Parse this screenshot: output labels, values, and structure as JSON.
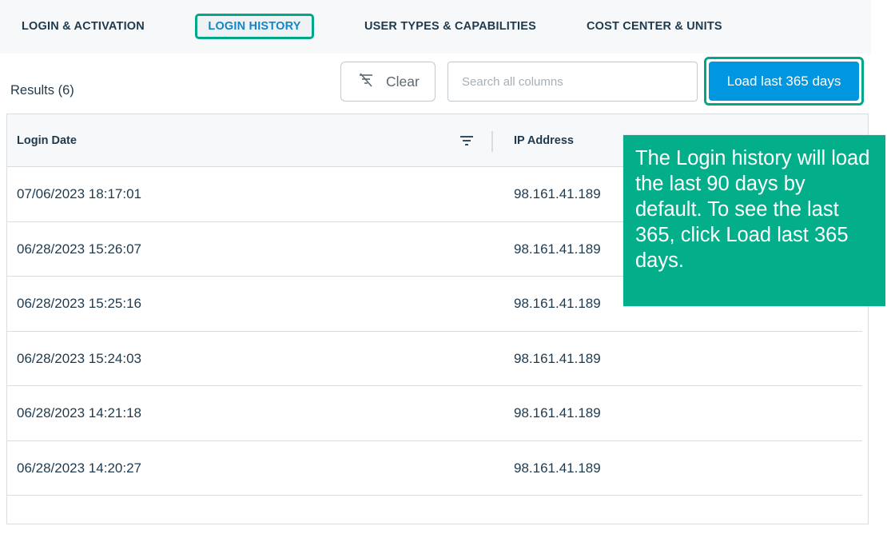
{
  "tabs": [
    {
      "label": "LOGIN & ACTIVATION"
    },
    {
      "label": "LOGIN HISTORY"
    },
    {
      "label": "USER TYPES & CAPABILITIES"
    },
    {
      "label": "COST CENTER & UNITS"
    }
  ],
  "toolbar": {
    "results_label": "Results (6)",
    "clear_label": "Clear",
    "search_placeholder": "Search all columns",
    "load_label": "Load last 365 days"
  },
  "table": {
    "columns": [
      "Login Date",
      "IP Address"
    ],
    "rows": [
      {
        "login_date": "07/06/2023 18:17:01",
        "ip": "98.161.41.189"
      },
      {
        "login_date": "06/28/2023 15:26:07",
        "ip": "98.161.41.189"
      },
      {
        "login_date": "06/28/2023 15:25:16",
        "ip": "98.161.41.189"
      },
      {
        "login_date": "06/28/2023 15:24:03",
        "ip": "98.161.41.189"
      },
      {
        "login_date": "06/28/2023 14:21:18",
        "ip": "98.161.41.189"
      },
      {
        "login_date": "06/28/2023 14:20:27",
        "ip": "98.161.41.189"
      }
    ]
  },
  "callout": {
    "text": "The Login history will load the last 90 days by default. To see the last 365, click Load last 365 days."
  },
  "icons": {
    "clear": "filter-clear-icon",
    "column_filter": "filter-lines-icon"
  },
  "colors": {
    "accent_blue": "#0096e0",
    "highlight_green": "#00a887",
    "callout_green": "#03ae8a",
    "text_dark": "#1f3a4d",
    "active_tab_text": "#1186c7"
  }
}
